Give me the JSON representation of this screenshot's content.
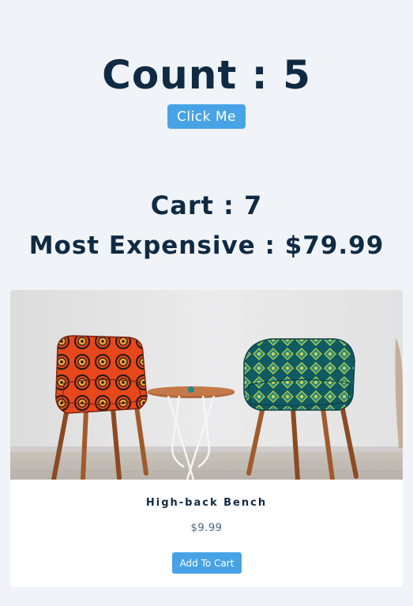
{
  "counter": {
    "title": "Count : 5"
  },
  "click_button": {
    "label": "Click Me"
  },
  "cart": {
    "title": "Cart : 7"
  },
  "most_expensive": {
    "title": "Most Expensive : $79.99"
  },
  "product": {
    "name": "High-back Bench",
    "price": "$9.99",
    "add_label": "Add To Cart",
    "image_icon": "two-patterned-chairs-image"
  },
  "colors": {
    "background": "#f0f4f8",
    "heading": "#102a43",
    "accent": "#47a3e6",
    "card": "#ffffff",
    "price_text": "#486581"
  }
}
